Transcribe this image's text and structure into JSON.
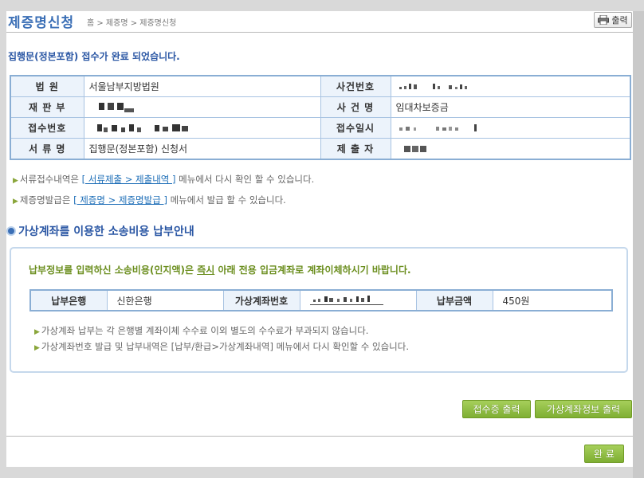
{
  "header": {
    "title": "제증명신청",
    "breadcrumb": "홈 > 제증명 > 제증명신청",
    "print_label": "출력"
  },
  "notice": "집행문(정본포함) 접수가 완료 되었습니다.",
  "info_table": {
    "court_label": "법 원",
    "court_value": "서울남부지방법원",
    "case_no_label": "사건번호",
    "division_label": "재 판 부",
    "case_name_label": "사 건 명",
    "case_name_value": "임대차보증금",
    "receipt_no_label": "접수번호",
    "receipt_date_label": "접수일시",
    "doc_name_label": "서 류 명",
    "doc_name_value": "집행문(정본포함) 신청서",
    "submitter_label": "제 출 자"
  },
  "notes": {
    "line1_prefix": "서류접수내역은",
    "line1_link": "[ 서류제출 > 제출내역 ]",
    "line1_suffix": "메뉴에서 다시 확인 할 수 있습니다.",
    "line2_prefix": "제증명발급은",
    "line2_link": "[ 제증명 > 제증명발급 ]",
    "line2_suffix": "메뉴에서 발급 할 수 있습니다."
  },
  "section_title": "가상계좌를 이용한 소송비용 납부안내",
  "payment": {
    "msg_prefix": "납부정보를 입력하신 소송비용(인지액)은",
    "msg_emph": "즉시",
    "msg_suffix": "아래 전용 입금계좌로 계좌이체하시기 바랍니다.",
    "bank_label": "납부은행",
    "bank_value": "신한은행",
    "account_label": "가상계좌번호",
    "amount_label": "납부금액",
    "amount_value": "450원",
    "note1": "가상계좌 납부는 각 은행별 계좌이체 수수료 이외 별도의 수수료가 부과되지 않습니다.",
    "note2": "가상계좌번호 발급 및 납부내역은 [납부/환급>가상계좌내역] 메뉴에서 다시 확인할 수 있습니다."
  },
  "buttons": {
    "receipt_print": "접수증 출력",
    "account_print": "가상계좌정보 출력",
    "done": "완 료"
  },
  "colors": {
    "accent": "#3b6fb6",
    "label_bg": "#ecf3fb",
    "button_green": "#8dbb42",
    "highlight_green": "#6b8e1e"
  }
}
